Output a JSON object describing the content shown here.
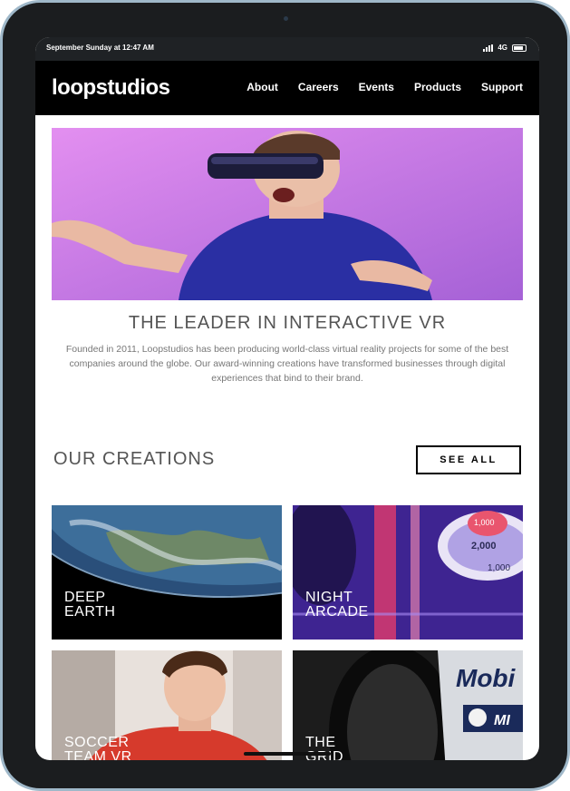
{
  "status": {
    "time": "September Sunday at 12:47 AM",
    "network": "4G"
  },
  "brand": {
    "logo": "loopstudios"
  },
  "nav": {
    "items": [
      "About",
      "Careers",
      "Events",
      "Products",
      "Support"
    ]
  },
  "hero": {
    "image": "vr-headset-person",
    "headline": "THE LEADER IN INTERACTIVE VR",
    "description": "Founded in 2011, Loopstudios has been producing world-class virtual reality projects for some of the best companies around the globe. Our award-winning creations have transformed businesses through digital experiences that bind to their brand."
  },
  "creations": {
    "title": "OUR CREATIONS",
    "see_all": "SEE ALL",
    "cards": [
      {
        "title": "DEEP\nEARTH",
        "image": "earth-from-space"
      },
      {
        "title": "NIGHT\nARCADE",
        "image": "arcade-machine"
      },
      {
        "title": "SOCCER\nTEAM VR",
        "image": "soccer-player"
      },
      {
        "title": "THE\nGRID",
        "image": "race-car"
      }
    ]
  },
  "colors": {
    "nav_bg": "#000000",
    "hero_bg": "#c77ee6",
    "text": "#555555",
    "device_frame": "#1b1d1f"
  }
}
